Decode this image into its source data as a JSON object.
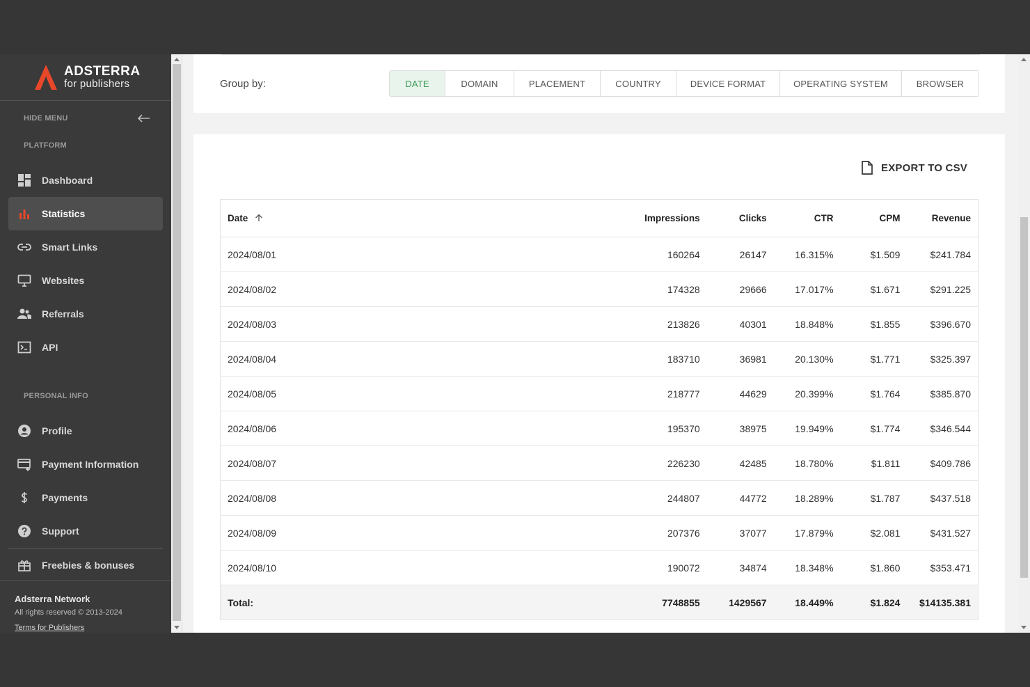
{
  "brand": {
    "name": "ADSTERRA",
    "tagline": "for publishers",
    "accent": "#e8472a"
  },
  "sidebar": {
    "hide_menu": "HIDE MENU",
    "platform_label": "PLATFORM",
    "platform_items": [
      {
        "label": "Dashboard",
        "icon": "dashboard-icon"
      },
      {
        "label": "Statistics",
        "icon": "bar-chart-icon",
        "active": true
      },
      {
        "label": "Smart Links",
        "icon": "link-icon"
      },
      {
        "label": "Websites",
        "icon": "monitor-icon"
      },
      {
        "label": "Referrals",
        "icon": "people-icon"
      },
      {
        "label": "API",
        "icon": "terminal-icon"
      }
    ],
    "personal_label": "PERSONAL INFO",
    "personal_items": [
      {
        "label": "Profile",
        "icon": "account-circle-icon"
      },
      {
        "label": "Payment Information",
        "icon": "credit-card-add-icon"
      },
      {
        "label": "Payments",
        "icon": "dollar-icon"
      },
      {
        "label": "Support",
        "icon": "help-circle-icon"
      }
    ],
    "extra_items": [
      {
        "label": "Freebies & bonuses",
        "icon": "gift-icon"
      }
    ],
    "footer": {
      "title": "Adsterra Network",
      "copyright": "All rights reserved © 2013-2024",
      "terms": "Terms for Publishers"
    }
  },
  "group_by": {
    "label": "Group by:",
    "tabs": [
      "DATE",
      "DOMAIN",
      "PLACEMENT",
      "COUNTRY",
      "DEVICE FORMAT",
      "OPERATING SYSTEM",
      "BROWSER"
    ],
    "active": "DATE",
    "active_color": "#3b9a57"
  },
  "export": {
    "label": "EXPORT TO CSV"
  },
  "table": {
    "headers": [
      "Date",
      "Impressions",
      "Clicks",
      "CTR",
      "CPM",
      "Revenue"
    ],
    "sort_column": "Date",
    "rows": [
      [
        "2024/08/01",
        "160264",
        "26147",
        "16.315%",
        "$1.509",
        "$241.784"
      ],
      [
        "2024/08/02",
        "174328",
        "29666",
        "17.017%",
        "$1.671",
        "$291.225"
      ],
      [
        "2024/08/03",
        "213826",
        "40301",
        "18.848%",
        "$1.855",
        "$396.670"
      ],
      [
        "2024/08/04",
        "183710",
        "36981",
        "20.130%",
        "$1.771",
        "$325.397"
      ],
      [
        "2024/08/05",
        "218777",
        "44629",
        "20.399%",
        "$1.764",
        "$385.870"
      ],
      [
        "2024/08/06",
        "195370",
        "38975",
        "19.949%",
        "$1.774",
        "$346.544"
      ],
      [
        "2024/08/07",
        "226230",
        "42485",
        "18.780%",
        "$1.811",
        "$409.786"
      ],
      [
        "2024/08/08",
        "244807",
        "44772",
        "18.289%",
        "$1.787",
        "$437.518"
      ],
      [
        "2024/08/09",
        "207376",
        "37077",
        "17.879%",
        "$2.081",
        "$431.527"
      ],
      [
        "2024/08/10",
        "190072",
        "34874",
        "18.348%",
        "$1.860",
        "$353.471"
      ]
    ],
    "total": [
      "Total:",
      "7748855",
      "1429567",
      "18.449%",
      "$1.824",
      "$14135.381"
    ]
  }
}
